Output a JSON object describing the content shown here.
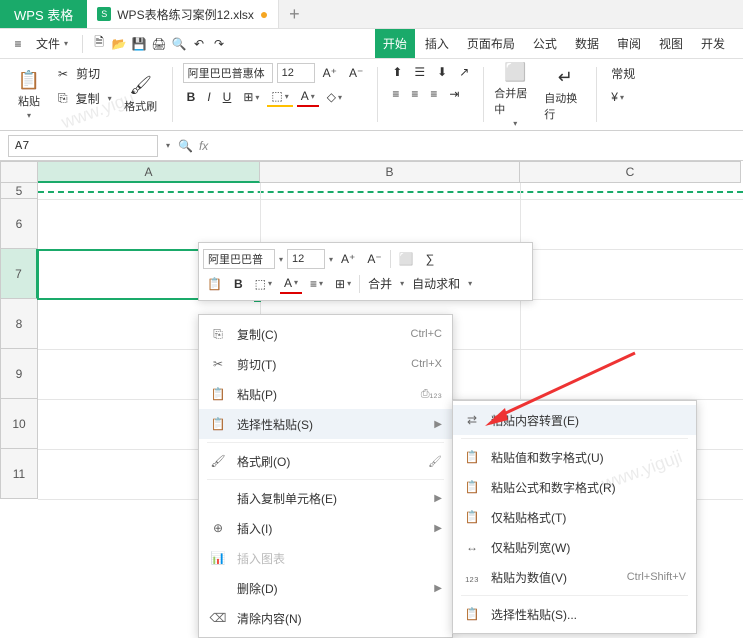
{
  "app": {
    "name": "WPS 表格"
  },
  "tab": {
    "title": "WPS表格练习案例12.xlsx",
    "doc_badge": "S"
  },
  "menu": {
    "file": "文件",
    "tabs": [
      "开始",
      "插入",
      "页面布局",
      "公式",
      "数据",
      "审阅",
      "视图",
      "开发"
    ],
    "active": "开始"
  },
  "ribbon": {
    "paste": "粘贴",
    "cut": "剪切",
    "copy": "复制",
    "format_painter": "格式刷",
    "font": "阿里巴巴普惠体",
    "size": "12",
    "merge_center": "合并居中",
    "auto_wrap": "自动换行",
    "normal": "常规"
  },
  "namebox": {
    "cell": "A7",
    "fx": "fx"
  },
  "columns": [
    "A",
    "B",
    "C"
  ],
  "rows": [
    "5",
    "6",
    "7",
    "8",
    "9",
    "10",
    "11"
  ],
  "float_tb": {
    "font": "阿里巴巴普",
    "size": "12",
    "merge": "合并",
    "autosum": "自动求和"
  },
  "context": {
    "copy": {
      "label": "复制(C)",
      "short": "Ctrl+C"
    },
    "cut": {
      "label": "剪切(T)",
      "short": "Ctrl+X"
    },
    "paste": {
      "label": "粘贴(P)"
    },
    "paste_special": {
      "label": "选择性粘贴(S)"
    },
    "format_painter": {
      "label": "格式刷(O)"
    },
    "insert_copied": {
      "label": "插入复制单元格(E)"
    },
    "insert": {
      "label": "插入(I)"
    },
    "insert_chart": {
      "label": "插入图表"
    },
    "delete": {
      "label": "删除(D)"
    },
    "clear": {
      "label": "清除内容(N)"
    }
  },
  "submenu": {
    "transpose": {
      "label": "粘贴内容转置(E)"
    },
    "values_number": {
      "label": "粘贴值和数字格式(U)"
    },
    "formula_number": {
      "label": "粘贴公式和数字格式(R)"
    },
    "format_only": {
      "label": "仅粘贴格式(T)"
    },
    "column_width": {
      "label": "仅粘贴列宽(W)"
    },
    "as_value": {
      "label": "粘贴为数值(V)",
      "short": "Ctrl+Shift+V"
    },
    "paste_special": {
      "label": "选择性粘贴(S)..."
    }
  },
  "watermarks": [
    "www.yigu",
    "www.yiguji"
  ]
}
